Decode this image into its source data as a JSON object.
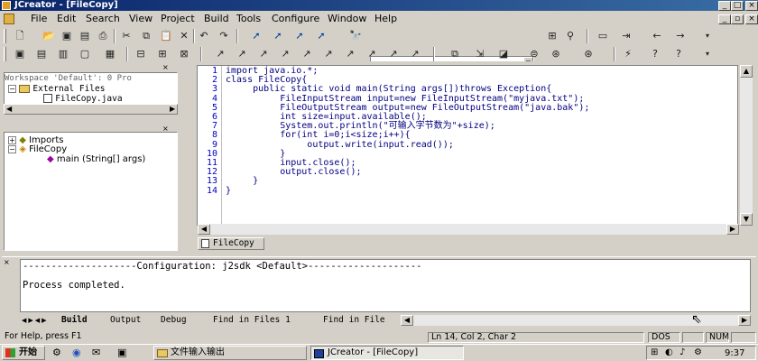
{
  "window": {
    "title": "JCreator - [FileCopy]",
    "controls": [
      "_",
      "□",
      "×"
    ],
    "doc_controls": [
      "_",
      "▫",
      "×"
    ]
  },
  "menu": [
    "File",
    "Edit",
    "Search",
    "View",
    "Project",
    "Build",
    "Tools",
    "Configure",
    "Window",
    "Help"
  ],
  "workspace": {
    "header": "Workspace 'Default': 0 Pro",
    "items": [
      "External Files",
      "FileCopy.java"
    ]
  },
  "classview": {
    "items": [
      "Imports",
      "FileCopy",
      "main (String[] args)"
    ]
  },
  "editor": {
    "line_numbers": [
      "1",
      "2",
      "3",
      "4",
      "5",
      "6",
      "7",
      "8",
      "9",
      "10",
      "11",
      "12",
      "13",
      "14"
    ],
    "lines": [
      "import java.io.*;",
      "class FileCopy{",
      "     public static void main(String args[])throws Exception{",
      "          FileInputStream input=new FileInputStream(\"myjava.txt\");",
      "          FileOutputStream output=new FileOutputStream(\"java.bak\");",
      "          int size=input.available();",
      "          System.out.println(\"可输入字节数为\"+size);",
      "          for(int i=0;i<size;i++){",
      "               output.write(input.read());",
      "          }",
      "          input.close();",
      "          output.close();",
      "     }",
      "}"
    ],
    "doc_tab": "FileCopy"
  },
  "output": {
    "line1": "--------------------Configuration: j2sdk <Default>--------------------",
    "line2": "Process completed.",
    "tabs": [
      "Build",
      "Output",
      "Debug",
      "Find in Files 1",
      "Find in File"
    ]
  },
  "status": {
    "help": "For Help, press F1",
    "position": "Ln 14, Col 2, Char 2",
    "dos": "DOS",
    "num": "NUM"
  },
  "taskbar": {
    "start": "开始",
    "folder": "文件输入输出",
    "app": "JCreator - [FileCopy]",
    "time": "9:37"
  }
}
